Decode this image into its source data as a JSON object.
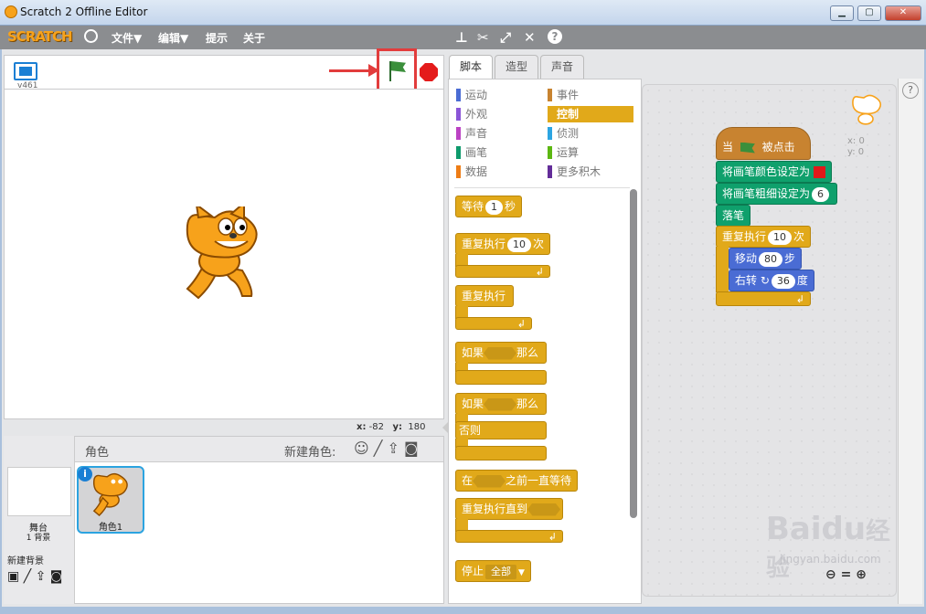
{
  "window": {
    "title": "Scratch 2 Offline Editor",
    "min": "▁",
    "max": "▢",
    "close": "✕"
  },
  "menu": {
    "logo": "SCRATCH",
    "file": "文件▼",
    "edit": "编辑▼",
    "tips": "提示",
    "about": "关于"
  },
  "stage": {
    "version": "v461",
    "x_label": "x:",
    "x_val": "-82",
    "y_label": "y:",
    "y_val": "180"
  },
  "tabs": [
    "脚本",
    "造型",
    "声音"
  ],
  "categories_left": [
    {
      "label": "运动",
      "color": "#4a6cd4"
    },
    {
      "label": "外观",
      "color": "#8a55d7"
    },
    {
      "label": "声音",
      "color": "#bb42c3"
    },
    {
      "label": "画笔",
      "color": "#0e9a6c"
    },
    {
      "label": "数据",
      "color": "#ee7d16"
    }
  ],
  "categories_right": [
    {
      "label": "事件",
      "color": "#c88330"
    },
    {
      "label": "控制",
      "color": "#e1a91a"
    },
    {
      "label": "侦测",
      "color": "#2ca5e2"
    },
    {
      "label": "运算",
      "color": "#5cb712"
    },
    {
      "label": "更多积木",
      "color": "#632d99"
    }
  ],
  "palette": {
    "wait": "等待",
    "wait_val": "1",
    "sec": "秒",
    "repeat": "重复执行",
    "repeat_val": "10",
    "times": "次",
    "forever": "重复执行",
    "if": "如果",
    "then": "那么",
    "else": "否则",
    "until_pre": "在",
    "until_post": "之前一直等待",
    "repeat_until": "重复执行直到",
    "stop": "停止",
    "stop_opt": "全部"
  },
  "script": {
    "when": "当",
    "clicked": "被点击",
    "set_color": "将画笔颜色设定为",
    "set_size": "将画笔粗细设定为",
    "size_val": "6",
    "pen_down": "落笔",
    "repeat": "重复执行",
    "repeat_val": "10",
    "times": "次",
    "move": "移动",
    "move_val": "80",
    "steps": "步",
    "turn": "右转",
    "turn_val": "36",
    "degrees": "度",
    "sprite_x": "x: 0",
    "sprite_y": "y: 0"
  },
  "sprites": {
    "header": "角色",
    "new_sprite": "新建角色:",
    "stage_label": "舞台",
    "backdrops": "1 背景",
    "new_backdrop": "新建背景",
    "sprite1": "角色1"
  },
  "watermark": {
    "brand": "Bai",
    "brand2": "du",
    "cn": "经验",
    "url": "jingyan.baidu.com"
  },
  "help": "?"
}
